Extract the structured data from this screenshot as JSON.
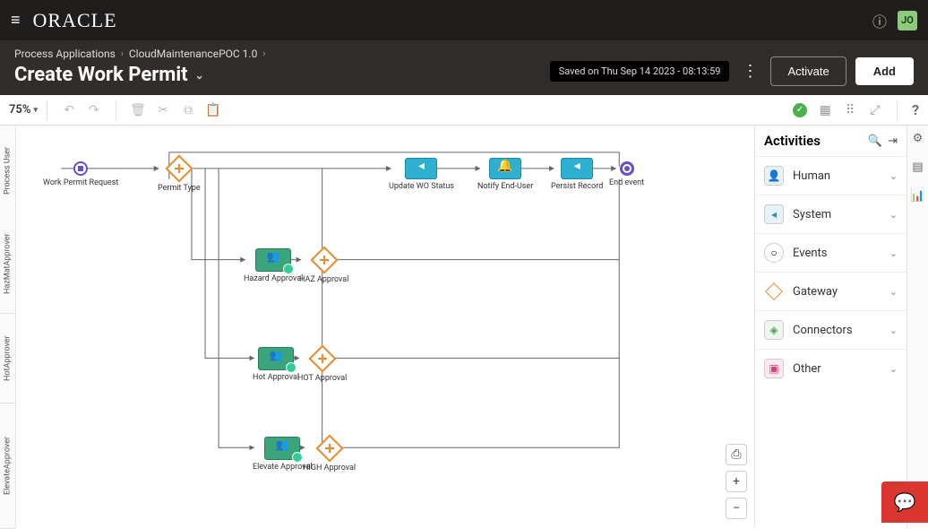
{
  "brand": "ORACLE",
  "user_initials": "JO",
  "breadcrumb": [
    "Process Applications",
    "CloudMaintenancePOC 1.0"
  ],
  "page_title": "Create Work Permit",
  "saved_text": "Saved on Thu Sep 14 2023 - 08:13:59",
  "btn_activate": "Activate",
  "btn_add": "Add",
  "zoom": "75%",
  "lanes": [
    "Process User",
    "HazMatApprover",
    "HotApprover",
    "ElevateApprover"
  ],
  "nodes": {
    "start": "Work Permit Request",
    "permit_type_gw": "Permit Type",
    "update_wo": "Update WO Status",
    "notify": "Notify End-User",
    "persist": "Persist Record",
    "end": "End event",
    "hazard_approval": "Hazard Approval",
    "haz_gw": "HAZ Approval",
    "hot_approval": "Hot Approval",
    "hot_gw": "HOT Approval",
    "elevate_approval": "Elevate Approval",
    "high_gw": "HIGH Approval"
  },
  "activities": {
    "title": "Activities",
    "items": [
      {
        "name": "Human",
        "kind": "human"
      },
      {
        "name": "System",
        "kind": "system"
      },
      {
        "name": "Events",
        "kind": "events"
      },
      {
        "name": "Gateway",
        "kind": "gateway"
      },
      {
        "name": "Connectors",
        "kind": "connectors"
      },
      {
        "name": "Other",
        "kind": "other"
      }
    ]
  }
}
